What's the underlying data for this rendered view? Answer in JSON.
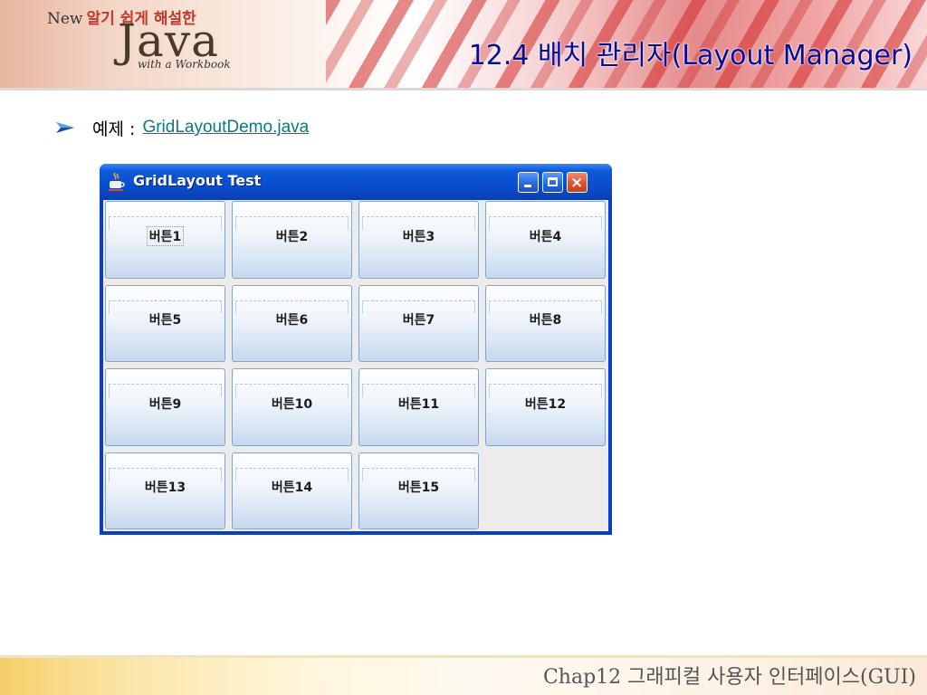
{
  "header": {
    "logo_new": "New",
    "logo_tagline": "알기 쉽게 해설한",
    "logo_java": "Java",
    "logo_workbook": "with a Workbook",
    "title": "12.4 배치 관리자(Layout Manager)"
  },
  "bullet": {
    "icon": "arrow-bullet-icon",
    "label": "예제 : ",
    "link": "GridLayoutDemo.java"
  },
  "window": {
    "title": "GridLayout Test",
    "app_icon": "java-cup-icon",
    "controls": {
      "minimize": "minimize-icon",
      "maximize": "maximize-icon",
      "close": "×"
    },
    "buttons": [
      "버튼1",
      "버튼2",
      "버튼3",
      "버튼4",
      "버튼5",
      "버튼6",
      "버튼7",
      "버튼8",
      "버튼9",
      "버튼10",
      "버튼11",
      "버튼12",
      "버튼13",
      "버튼14",
      "버튼15"
    ],
    "focused_button": "버튼1"
  },
  "footer": {
    "text": "Chap12 그래피컬 사용자 인터페이스(GUI)"
  },
  "colors": {
    "title_text": "#0a0a9a",
    "link": "#0a7a7a",
    "titlebar": "#0a4fd0"
  }
}
